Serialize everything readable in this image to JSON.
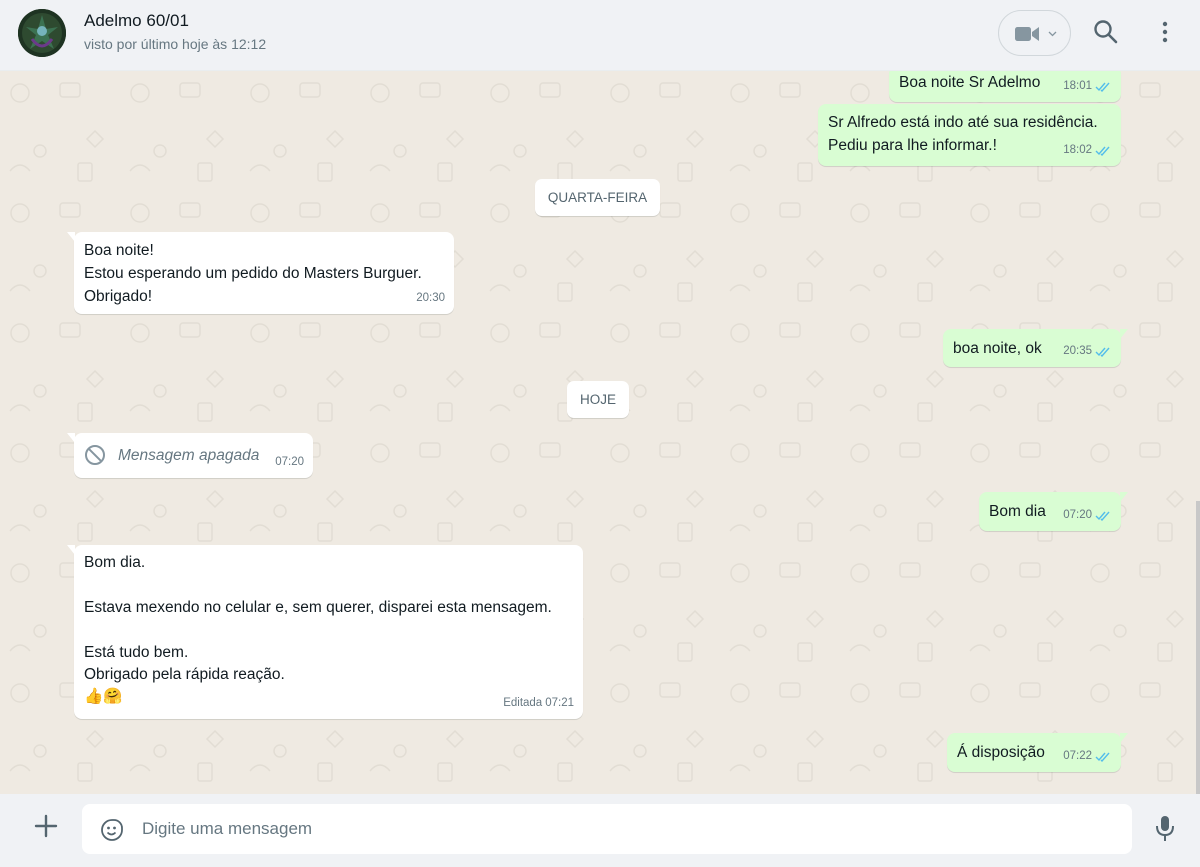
{
  "header": {
    "contact_name": "Adelmo 60/01",
    "last_seen": "visto por último hoje às 12:12",
    "icons": [
      "avatar",
      "video-call-icon",
      "chevron-down-icon",
      "search-icon",
      "kebab-menu-icon"
    ]
  },
  "messages": [
    {
      "id": "m1",
      "direction": "out",
      "text": "Boa noite Sr Adelmo",
      "time": "18:01",
      "ticks": "read"
    },
    {
      "id": "m2",
      "direction": "out",
      "text": "Sr Alfredo está indo até sua residência.\nPediu para lhe informar.!",
      "time": "18:02",
      "ticks": "read"
    },
    {
      "id": "d1",
      "type": "date",
      "text": "QUARTA-FEIRA"
    },
    {
      "id": "m3",
      "direction": "in",
      "text": "Boa noite!\nEstou esperando um pedido do Masters Burguer.\nObrigado!",
      "time": "20:30"
    },
    {
      "id": "m4",
      "direction": "out",
      "text": "boa noite, ok",
      "time": "20:35",
      "ticks": "read"
    },
    {
      "id": "d2",
      "type": "date",
      "text": "HOJE"
    },
    {
      "id": "m5",
      "direction": "in",
      "deleted": true,
      "text": "Mensagem apagada",
      "time": "07:20"
    },
    {
      "id": "m6",
      "direction": "out",
      "text": "Bom dia",
      "time": "07:20",
      "ticks": "read"
    },
    {
      "id": "m7",
      "direction": "in",
      "text": "Bom dia.\n\nEstava mexendo no celular e, sem querer, disparei esta mensagem.\n\nEstá tudo bem.\nObrigado pela rápida reação.\n👍🤗",
      "time": "07:21",
      "edited_label": "Editada"
    },
    {
      "id": "m8",
      "direction": "out",
      "text": "Á disposição",
      "time": "07:22",
      "ticks": "read"
    }
  ],
  "footer": {
    "placeholder": "Digite uma mensagem",
    "icons": [
      "plus-icon",
      "sticker-icon",
      "microphone-icon"
    ]
  },
  "colors": {
    "outgoing_bubble": "#d9fdd3",
    "incoming_bubble": "#ffffff",
    "chat_background": "#efeae2",
    "read_ticks": "#53bdeb",
    "header_background": "#f0f2f5"
  }
}
